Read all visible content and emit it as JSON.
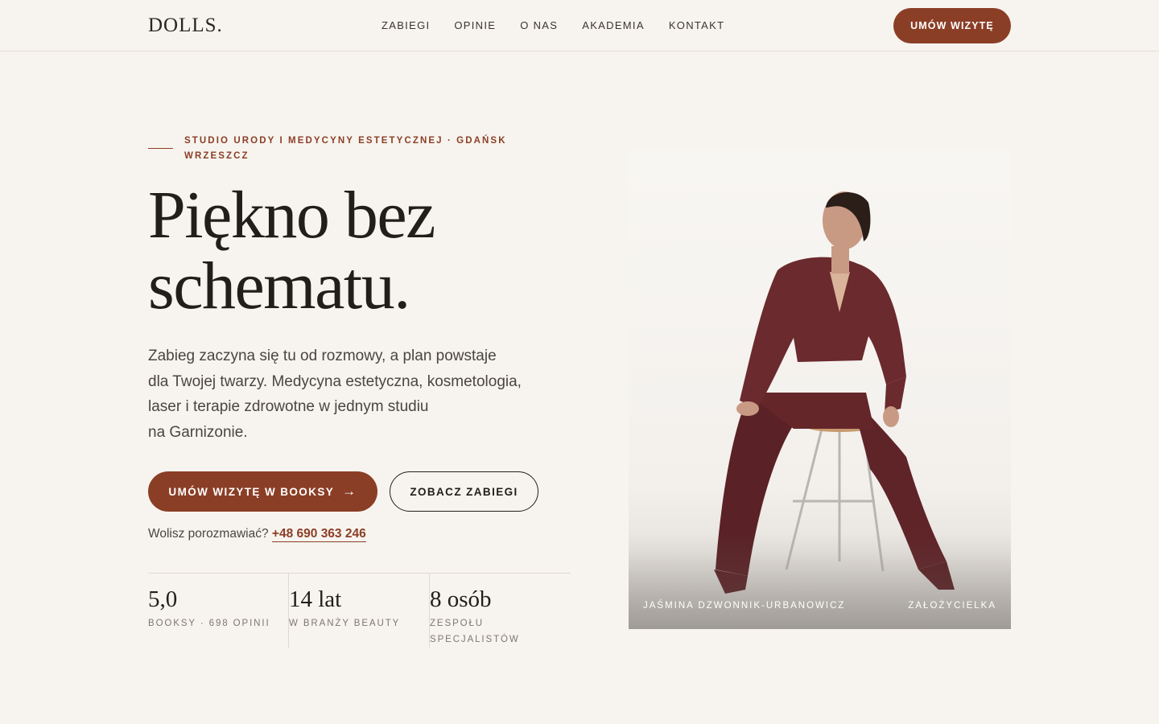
{
  "header": {
    "logo": "DOLLS.",
    "nav": [
      "ZABIEGI",
      "OPINIE",
      "O NAS",
      "AKADEMIA",
      "KONTAKT"
    ],
    "cta": "UMÓW WIZYTĘ"
  },
  "hero": {
    "eyebrow": "STUDIO URODY I MEDYCYNY ESTETYCZNEJ · GDAŃSK WRZESZCZ",
    "headline": [
      "Piękno bez",
      "schematu."
    ],
    "lead": [
      "Zabieg zaczyna się tu od rozmowy, a plan powstaje",
      "dla Twojej twarzy. Medycyna estetyczna, kosmetologia,",
      "laser i terapie zdrowotne w jednym studiu",
      "na Garnizonie."
    ],
    "primary_cta": "UMÓW WIZYTĘ W BOOKSY",
    "primary_cta_arrow": "→",
    "secondary_cta": "ZOBACZ ZABIEGI",
    "phone_prompt": "Wolisz porozmawiać?",
    "phone": "+48 690 363 246"
  },
  "stats": [
    {
      "value": "5,0",
      "label": "BOOKSY · 698 OPINII"
    },
    {
      "value": "14 lat",
      "label": "W BRANŻY BEAUTY"
    },
    {
      "value": "8 osób",
      "label": "ZESPOŁU SPECJALISTÓW"
    }
  ],
  "photo": {
    "name": "JAŚMINA DZWONNIK-URBANOWICZ",
    "role": "ZAŁOŻYCIELKA"
  },
  "colors": {
    "accent": "#8b3e26",
    "background": "#f7f4ef",
    "text": "#221e1a"
  }
}
